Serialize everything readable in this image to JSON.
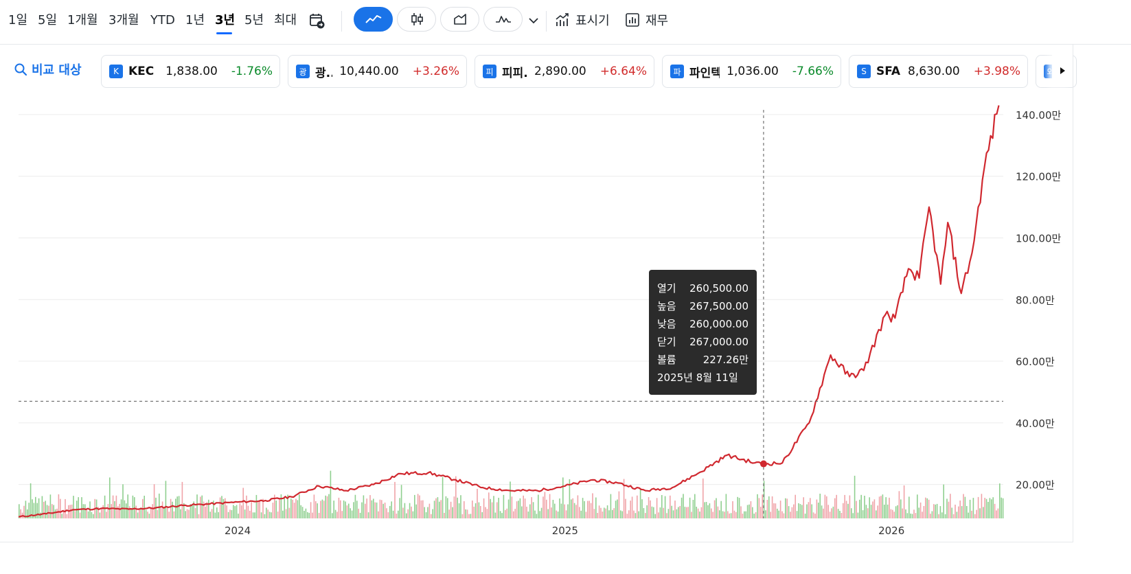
{
  "toolbar": {
    "ranges": [
      "1일",
      "5일",
      "1개월",
      "3개월",
      "YTD",
      "1년",
      "3년",
      "5년",
      "최대"
    ],
    "active_range": "3년",
    "chart_types": [
      "line-chart-icon",
      "candlestick-icon",
      "area-chart-icon",
      "mountain-chart-icon"
    ],
    "indicators_label": "표시기",
    "financials_label": "재무"
  },
  "compare": {
    "label": "비교 대상",
    "items": [
      {
        "badge": "K",
        "name": "KEC",
        "price": "1,838.00",
        "change": "-1.76%",
        "direction": "down"
      },
      {
        "badge": "광",
        "name": "광...",
        "price": "10,440.00",
        "change": "+3.26%",
        "direction": "up"
      },
      {
        "badge": "피",
        "name": "피피...",
        "price": "2,890.00",
        "change": "+6.64%",
        "direction": "up"
      },
      {
        "badge": "파",
        "name": "파인텍",
        "price": "1,036.00",
        "change": "-7.66%",
        "direction": "down"
      },
      {
        "badge": "S",
        "name": "SFA...",
        "price": "8,630.00",
        "change": "+3.98%",
        "direction": "up"
      },
      {
        "badge": "와",
        "name": "",
        "price": "",
        "change": "",
        "direction": "up"
      }
    ]
  },
  "tooltip": {
    "rows": [
      {
        "label": "열기",
        "value": "260,500.00"
      },
      {
        "label": "높음",
        "value": "267,500.00"
      },
      {
        "label": "낮음",
        "value": "260,000.00"
      },
      {
        "label": "닫기",
        "value": "267,000.00"
      },
      {
        "label": "볼륨",
        "value": "227.26만"
      }
    ],
    "date": "2025년 8월 11일"
  },
  "colors": {
    "accent": "#1a73e8",
    "line": "#d0282f",
    "volume_up": "#f0a3a8",
    "volume_down": "#8fcf8f",
    "positive": "#d12b2b",
    "negative": "#0a8a2a"
  },
  "chart_data": {
    "type": "line",
    "x_axis": {
      "tick_labels": [
        "2024",
        "2025",
        "2026"
      ],
      "range": [
        "2023-05-01",
        "2026-05-06"
      ]
    },
    "y_axis": {
      "tick_labels": [
        "20.00만",
        "40.00만",
        "60.00만",
        "80.00만",
        "100.00만",
        "120.00만",
        "140.00만"
      ],
      "range": [
        9,
        146
      ],
      "unit": "만",
      "position": "right"
    },
    "grid": true,
    "crosshair": {
      "date": "2025-08-11",
      "y": 47
    },
    "series": [
      {
        "points": [
          [
            "2023-05-01",
            9.5
          ],
          [
            "2023-06-01",
            10.5
          ],
          [
            "2023-07-01",
            11.8
          ],
          [
            "2023-08-01",
            12.2
          ],
          [
            "2023-09-01",
            12.0
          ],
          [
            "2023-10-01",
            12.4
          ],
          [
            "2023-11-01",
            13.2
          ],
          [
            "2023-12-01",
            13.7
          ],
          [
            "2024-01-01",
            14.3
          ],
          [
            "2024-02-01",
            14.8
          ],
          [
            "2024-03-01",
            16.0
          ],
          [
            "2024-04-01",
            19.5
          ],
          [
            "2024-05-01",
            18.0
          ],
          [
            "2024-06-01",
            20.0
          ],
          [
            "2024-07-01",
            23.5
          ],
          [
            "2024-08-01",
            23.8
          ],
          [
            "2024-09-01",
            21.5
          ],
          [
            "2024-10-01",
            19.0
          ],
          [
            "2024-11-01",
            18.0
          ],
          [
            "2024-12-01",
            18.0
          ],
          [
            "2025-01-01",
            19.5
          ],
          [
            "2025-02-01",
            21.5
          ],
          [
            "2025-03-01",
            20.5
          ],
          [
            "2025-04-01",
            18.0
          ],
          [
            "2025-05-01",
            19.0
          ],
          [
            "2025-06-01",
            24.0
          ],
          [
            "2025-07-01",
            29.5
          ],
          [
            "2025-08-01",
            27.0
          ],
          [
            "2025-08-11",
            26.7
          ],
          [
            "2025-09-01",
            27.0
          ],
          [
            "2025-10-01",
            40.0
          ],
          [
            "2025-10-25",
            62.0
          ],
          [
            "2025-11-15",
            55.0
          ],
          [
            "2025-12-01",
            57.0
          ],
          [
            "2025-12-25",
            75.0
          ],
          [
            "2026-01-05",
            74.0
          ],
          [
            "2026-01-20",
            90.0
          ],
          [
            "2026-02-01",
            87.0
          ],
          [
            "2026-02-12",
            110.0
          ],
          [
            "2026-02-25",
            85.0
          ],
          [
            "2026-03-05",
            105.0
          ],
          [
            "2026-03-20",
            82.0
          ],
          [
            "2026-04-01",
            95.0
          ],
          [
            "2026-04-15",
            123.0
          ],
          [
            "2026-05-01",
            143.0
          ]
        ]
      }
    ]
  }
}
